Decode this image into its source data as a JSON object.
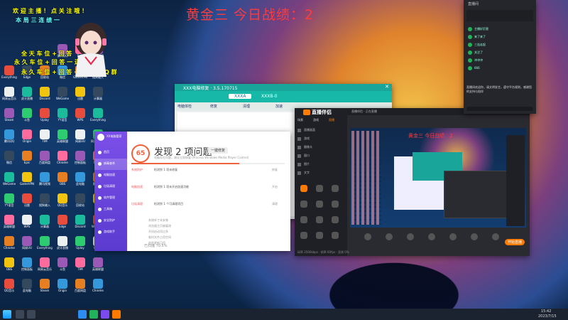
{
  "overlay": {
    "title": "黄金三 今日战绩：2",
    "notices": [
      "欢 迎 主 播 ！ 点 关 注 哦 ！",
      "本 局 三 连 绩 一",
      "全 天 车 位 + 回 答",
      "永 久 车 位 + 回 答 一 送 一",
      "永 久 车 位 + 回 答 · V X + Q Q 群"
    ]
  },
  "desktop": {
    "icon_labels": [
      "Everything",
      "网易云音乐",
      "Steam",
      "腾讯QQ",
      "微信",
      "WeGame",
      "YY语音",
      "英雄联盟",
      "Chrome",
      "OBS",
      "QQ音乐",
      "Edge",
      "虎牙直播",
      "斗鱼",
      "Origin",
      "Epic",
      "GameVPN",
      "迅雷",
      "WPS",
      "网易UU",
      "控制面板",
      "此电脑",
      "回收站",
      "Discord",
      "Uplay",
      "TIM",
      "百度网盘",
      "腾讯视频",
      "搜狗输入",
      "计算器"
    ]
  },
  "pc_manager": {
    "titlebar": "XX电脑管家",
    "nav": [
      "首页",
      "病毒查杀",
      "电脑加速",
      "垃圾清理",
      "软件管理",
      "工具箱",
      "安全防护",
      "游戏助手"
    ],
    "score": "65",
    "headline": "发现 2 项问题",
    "action_button": "一键修复",
    "subline": "电脑存在问题，建议立即修复 (Process Windows Media Player Control)",
    "sections": [
      {
        "label": "系统防护",
        "text": "检测到 1 项未修复",
        "status": "修复"
      },
      {
        "label": "电脑加速",
        "text": "检测到 1 项未开启加速功能",
        "status": "开启"
      },
      {
        "label": "垃圾清理",
        "text": "检测到 1 个可清理项目",
        "status": "清理"
      }
    ],
    "details": [
      "系统补丁未安装",
      "浏览器主页被篡改",
      "开机启动项过多",
      "临时文件占用空间",
      "软件更新可用"
    ],
    "footer": "已扫描 70.5%"
  },
  "manager2": {
    "title": "XXX电脑修复 · 3.5.170715",
    "tabs": [
      "XXXA",
      "XXXB-0"
    ],
    "toolbar": [
      "电脑体检",
      "修复",
      "清理",
      "加速"
    ]
  },
  "obs": {
    "brand": "直播伴侣",
    "title": "直播伴侣 · 正在直播",
    "tabs": [
      "场景",
      "游戏",
      "直播"
    ],
    "left_items": [
      "直播画面",
      "游戏",
      "摄像头",
      "窗口",
      "图片",
      "文字"
    ],
    "preview_title": "黄金三 今日战绩：2",
    "start_button": "开始直播",
    "status_bar": "码率 2500kbps · 帧率 60fps · 丢帧 0%"
  },
  "chat_panel": {
    "header": "直播间",
    "messages": [
      "主播好厉害",
      "来了来了",
      "三连走起",
      "关注了",
      "冲冲冲",
      "666"
    ],
    "footer_note": "直播间欢迎你，请文明发言，遵守平台规则，感谢您的支持与陪伴"
  },
  "taskbar": {
    "time": "15:42",
    "date": "2023/7/15"
  },
  "colors": {
    "title_red": "#ff3b3b",
    "accent_purple": "#7a4cf0",
    "obs_orange": "#ff7a00",
    "green": "#21b35a"
  }
}
